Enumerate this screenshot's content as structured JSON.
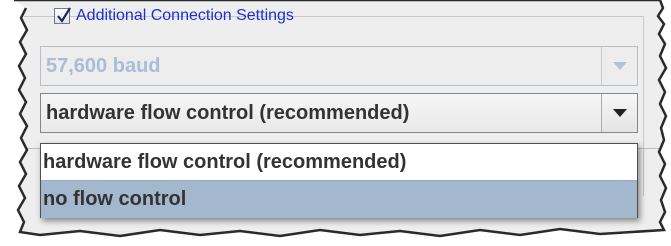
{
  "connection": {
    "checkbox_label": "Additional Connection Settings",
    "checkbox_checked": true
  },
  "baud_combo": {
    "value": "57,600 baud",
    "enabled": false
  },
  "flow_combo": {
    "value": "hardware flow control (recommended)",
    "enabled": true,
    "expanded": true,
    "options": [
      {
        "label": "hardware flow control (recommended)",
        "selected": false
      },
      {
        "label": "no flow control",
        "selected": true
      }
    ]
  },
  "icons": {
    "checkbox": "check-icon",
    "dropdown": "chevron-down-icon"
  },
  "colors": {
    "link_blue": "#1b2fd6",
    "disabled_text": "#a9bdd6",
    "selection": "#a3b8cc"
  }
}
